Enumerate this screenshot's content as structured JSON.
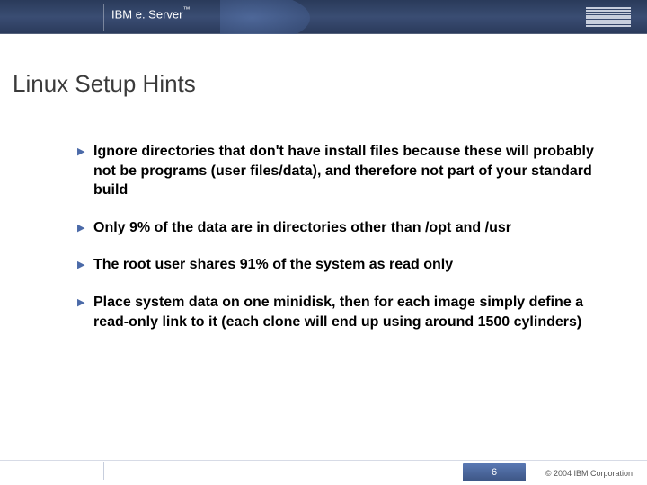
{
  "header": {
    "product_line": "IBM e. Server™"
  },
  "title": "Linux Setup Hints",
  "bullets": [
    "Ignore directories that don't have install files because these will probably not be programs (user files/data), and therefore not part of your standard build",
    "Only 9% of the data are in directories other than /opt and /usr",
    "The root user shares 91% of the system as read only",
    "Place system data on one minidisk, then for each image simply define a read-only link to it (each clone will end up using around 1500 cylinders)"
  ],
  "footer": {
    "page_number": "6",
    "copyright": "© 2004 IBM Corporation"
  }
}
